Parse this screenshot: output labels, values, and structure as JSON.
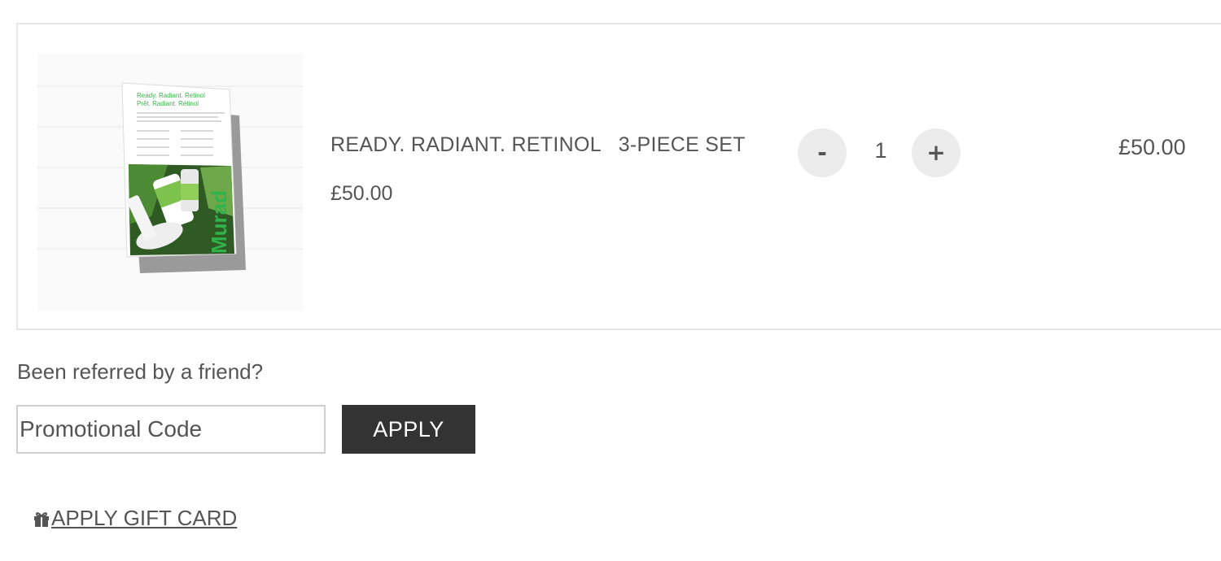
{
  "cart": {
    "item": {
      "name": "READY. RADIANT. RETINOL   3-PIECE SET",
      "unit_price": "£50.00",
      "quantity": "1",
      "line_total": "£50.00",
      "decrease_label": "-",
      "increase_label": "+",
      "image_icon": "product-box-image",
      "image_text": {
        "heading1": "Ready. Radiant. Retinol",
        "heading2": "Prêt. Radiant. Rétinol",
        "brand": "Murad"
      }
    }
  },
  "promo": {
    "referral_text": "Been referred by a friend?",
    "placeholder": "Promotional Code",
    "value": "",
    "apply_label": "APPLY"
  },
  "gift_card": {
    "icon": "gift-icon",
    "label": "APPLY GIFT CARD"
  },
  "colors": {
    "accent_dark": "#333333",
    "brand_green": "#3ab54a",
    "button_bg": "#ececec"
  }
}
